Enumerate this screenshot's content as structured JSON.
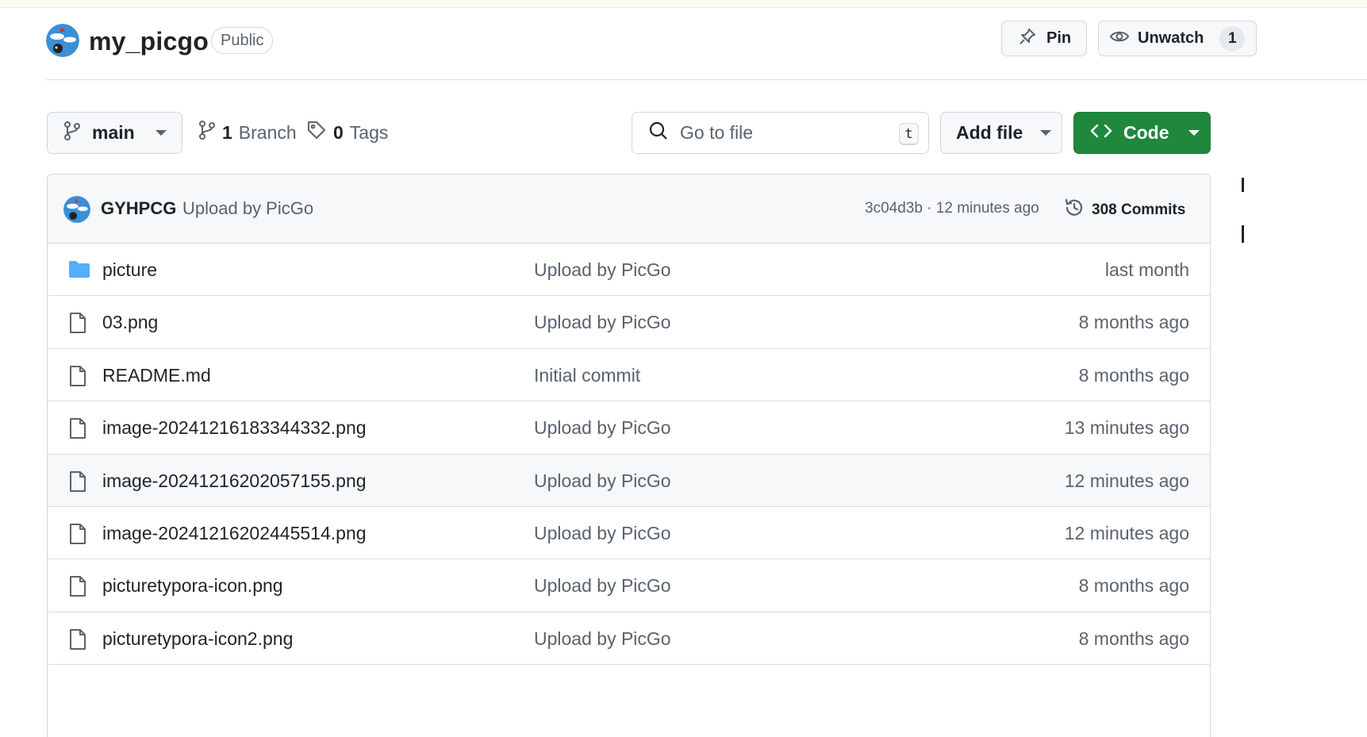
{
  "repo": {
    "name": "my_picgo",
    "visibility": "Public",
    "pin_label": "Pin",
    "unwatch_label": "Unwatch",
    "watch_count": "1"
  },
  "toolbar": {
    "branch": "main",
    "branch_count": "1",
    "branch_word": "Branch",
    "tag_count": "0",
    "tag_word": "Tags",
    "search_placeholder": "Go to file",
    "search_shortcut": "t",
    "add_file_label": "Add file",
    "code_label": "Code"
  },
  "latest_commit": {
    "author": "GYHPCG",
    "message": "Upload by PicGo",
    "sha_time": "3c04d3b · 12 minutes ago",
    "commits_label": "308 Commits"
  },
  "files": [
    {
      "type": "folder",
      "name": "picture",
      "message": "Upload by PicGo",
      "age": "last month"
    },
    {
      "type": "file",
      "name": "03.png",
      "message": "Upload by PicGo",
      "age": "8 months ago"
    },
    {
      "type": "file",
      "name": "README.md",
      "message": "Initial commit",
      "age": "8 months ago"
    },
    {
      "type": "file",
      "name": "image-20241216183344332.png",
      "message": "Upload by PicGo",
      "age": "13 minutes ago"
    },
    {
      "type": "file",
      "name": "image-20241216202057155.png",
      "message": "Upload by PicGo",
      "age": "12 minutes ago"
    },
    {
      "type": "file",
      "name": "image-20241216202445514.png",
      "message": "Upload by PicGo",
      "age": "12 minutes ago"
    },
    {
      "type": "file",
      "name": "picturetypora-icon.png",
      "message": "Upload by PicGo",
      "age": "8 months ago"
    },
    {
      "type": "file",
      "name": "picturetypora-icon2.png",
      "message": "Upload by PicGo",
      "age": "8 months ago"
    }
  ],
  "colors": {
    "code_button": "#1f883d",
    "folder_icon": "#54aeff",
    "muted_text": "#59636e",
    "border": "#d0d7de"
  }
}
